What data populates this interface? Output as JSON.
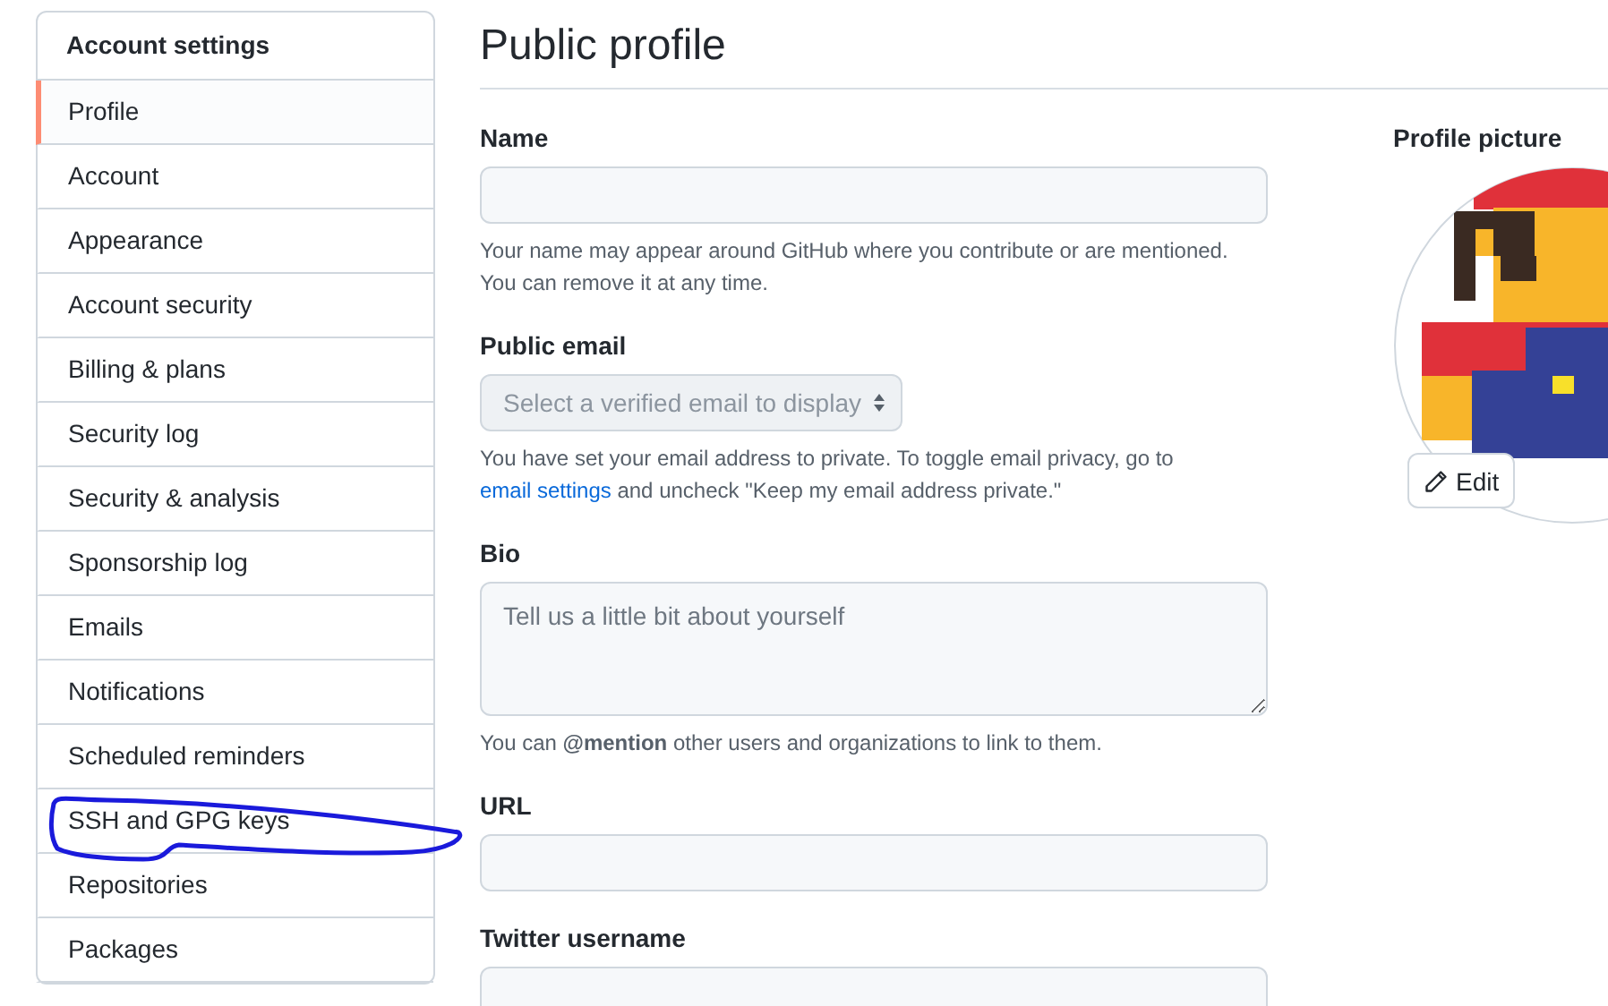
{
  "sidebar": {
    "title": "Account settings",
    "items": [
      {
        "label": "Profile",
        "selected": true,
        "circled": false
      },
      {
        "label": "Account",
        "selected": false,
        "circled": false
      },
      {
        "label": "Appearance",
        "selected": false,
        "circled": false
      },
      {
        "label": "Account security",
        "selected": false,
        "circled": false
      },
      {
        "label": "Billing & plans",
        "selected": false,
        "circled": false
      },
      {
        "label": "Security log",
        "selected": false,
        "circled": false
      },
      {
        "label": "Security & analysis",
        "selected": false,
        "circled": false
      },
      {
        "label": "Sponsorship log",
        "selected": false,
        "circled": false
      },
      {
        "label": "Emails",
        "selected": false,
        "circled": false
      },
      {
        "label": "Notifications",
        "selected": false,
        "circled": false
      },
      {
        "label": "Scheduled reminders",
        "selected": false,
        "circled": false
      },
      {
        "label": "SSH and GPG keys",
        "selected": false,
        "circled": true
      },
      {
        "label": "Repositories",
        "selected": false,
        "circled": false
      },
      {
        "label": "Packages",
        "selected": false,
        "circled": false
      }
    ]
  },
  "page_title": "Public profile",
  "fields": [
    {
      "kind": "text",
      "label": "Name",
      "note": [
        {
          "kind": "text",
          "text": "Your name may appear around GitHub where you contribute or are mentioned. You can remove it at any time."
        }
      ]
    },
    {
      "kind": "select",
      "label": "Public email",
      "placeholder": "Select a verified email to display",
      "note": [
        {
          "kind": "text",
          "text": "You have set your email address to private. To toggle email privacy, go to "
        },
        {
          "kind": "link",
          "text": "email settings"
        },
        {
          "kind": "text",
          "text": " and uncheck \"Keep my email address private.\""
        }
      ]
    },
    {
      "kind": "textarea",
      "label": "Bio",
      "placeholder": "Tell us a little bit about yourself",
      "note": [
        {
          "kind": "text",
          "text": "You can **@mention** other users and organizations to link to them."
        }
      ]
    },
    {
      "kind": "text",
      "label": "URL"
    },
    {
      "kind": "text",
      "label": "Twitter username"
    }
  ],
  "profile_picture": {
    "label": "Profile picture",
    "edit_button": "Edit"
  }
}
